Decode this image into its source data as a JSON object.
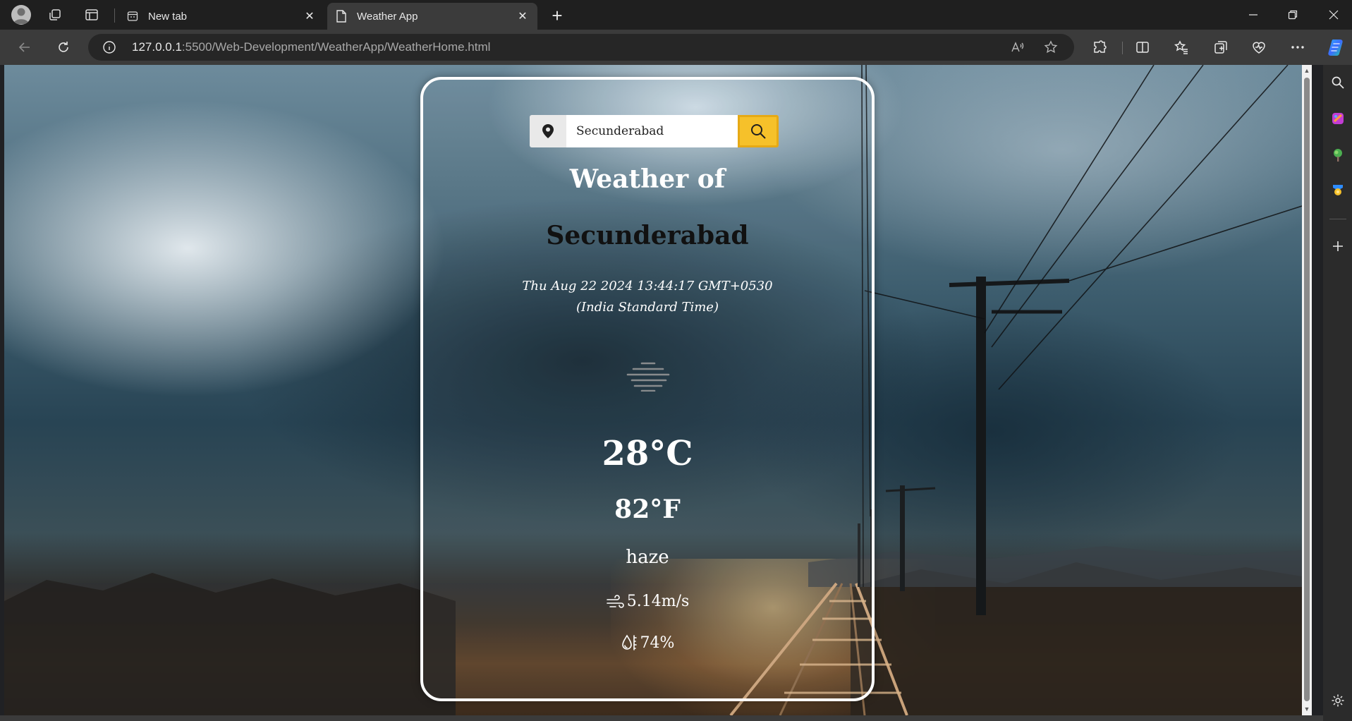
{
  "browser": {
    "tabs": [
      {
        "label": "New tab",
        "active": false
      },
      {
        "label": "Weather App",
        "active": true
      }
    ],
    "url_host": "127.0.0.1",
    "url_rest": ":5500/Web-Development/WeatherApp/WeatherHome.html"
  },
  "weather": {
    "search_value": "Secunderabad",
    "heading_line1": "Weather of",
    "city": "Secunderabad",
    "datetime_line1": "Thu Aug 22 2024 13:44:17 GMT+0530",
    "datetime_line2": "(India Standard Time)",
    "temp_c": "28°C",
    "temp_f": "82°F",
    "condition": "haze",
    "wind": "5.14m/s",
    "humidity": "74%",
    "icons": {
      "location": "map-pin-icon",
      "search": "magnifier-icon",
      "weather": "haze-icon",
      "wind": "wind-icon",
      "humidity": "droplet-icon"
    }
  },
  "colors": {
    "search_button": "#f6c12a",
    "card_border": "#ffffff",
    "city_text": "#111111"
  }
}
